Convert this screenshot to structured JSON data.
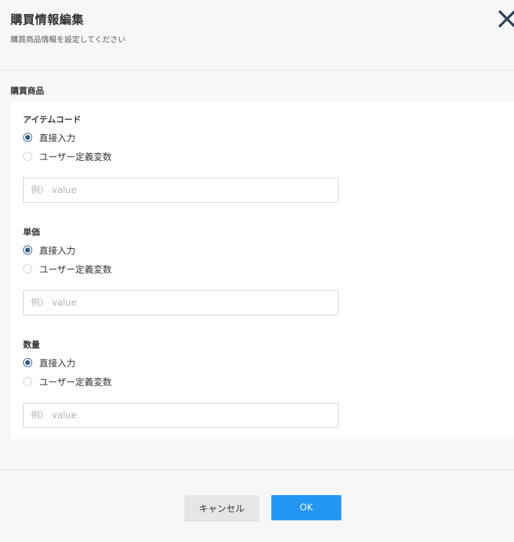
{
  "dialog": {
    "title": "購買情報編集",
    "subtitle": "購買商品情報を設定してください"
  },
  "section": {
    "title": "購買商品"
  },
  "fields": [
    {
      "label": "アイテムコード",
      "options": [
        {
          "label": "直接入力",
          "checked": true
        },
        {
          "label": "ユーザー定義変数",
          "checked": false
        }
      ],
      "placeholder": "例） value",
      "value": ""
    },
    {
      "label": "単価",
      "options": [
        {
          "label": "直接入力",
          "checked": true
        },
        {
          "label": "ユーザー定義変数",
          "checked": false
        }
      ],
      "placeholder": "例） value",
      "value": ""
    },
    {
      "label": "数量",
      "options": [
        {
          "label": "直接入力",
          "checked": true
        },
        {
          "label": "ユーザー定義変数",
          "checked": false
        }
      ],
      "placeholder": "例） value",
      "value": ""
    }
  ],
  "buttons": {
    "cancel": "キャンセル",
    "ok": "OK"
  },
  "colors": {
    "accent": "#2196f3",
    "radio_checked": "#2c5b87",
    "close_icon": "#2b3f5c"
  }
}
